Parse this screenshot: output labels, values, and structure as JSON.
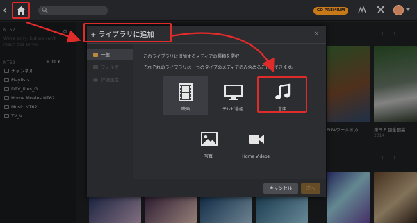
{
  "topbar": {
    "back_glyph": "‹",
    "premium_label": "GO PREMIUM",
    "search_placeholder": ""
  },
  "sidebar": {
    "server_heading": "NT62",
    "server_note_1": "We're sorry, but we can't",
    "server_note_2": "reach this server",
    "library_heading": "NT62",
    "items": [
      {
        "label": "チャンネル"
      },
      {
        "label": "Playlists"
      },
      {
        "label": "DTV_files_G"
      },
      {
        "label": "Home Movies NT62"
      },
      {
        "label": "Music NT62"
      },
      {
        "label": "TV_V"
      }
    ]
  },
  "background": {
    "caption_1": "FIFAワールドカ...",
    "caption_2": "第９６回全国高",
    "caption_2_sub": "2014"
  },
  "modal": {
    "title": "ライブラリに追加",
    "close_glyph": "×",
    "nav": [
      {
        "label": "一般"
      },
      {
        "label": "フォルダ"
      },
      {
        "label": "詳細設定"
      }
    ],
    "description_1": "このライブラリに追加するメディアの種類を選択",
    "description_2": "それぞれのライブラリは一つのタイプのメディアのみ含めることができます。",
    "types": [
      {
        "label": "映画",
        "icon": "film-icon"
      },
      {
        "label": "テレビ番組",
        "icon": "tv-icon"
      },
      {
        "label": "音楽",
        "icon": "music-icon"
      },
      {
        "label": "写真",
        "icon": "photo-icon"
      },
      {
        "label": "Home Videos",
        "icon": "video-camera-icon"
      }
    ],
    "cancel_label": "キャンセル",
    "next_label": "次へ"
  },
  "colors": {
    "annotation_red": "#e02b2b",
    "premium_orange": "#c97a18"
  }
}
